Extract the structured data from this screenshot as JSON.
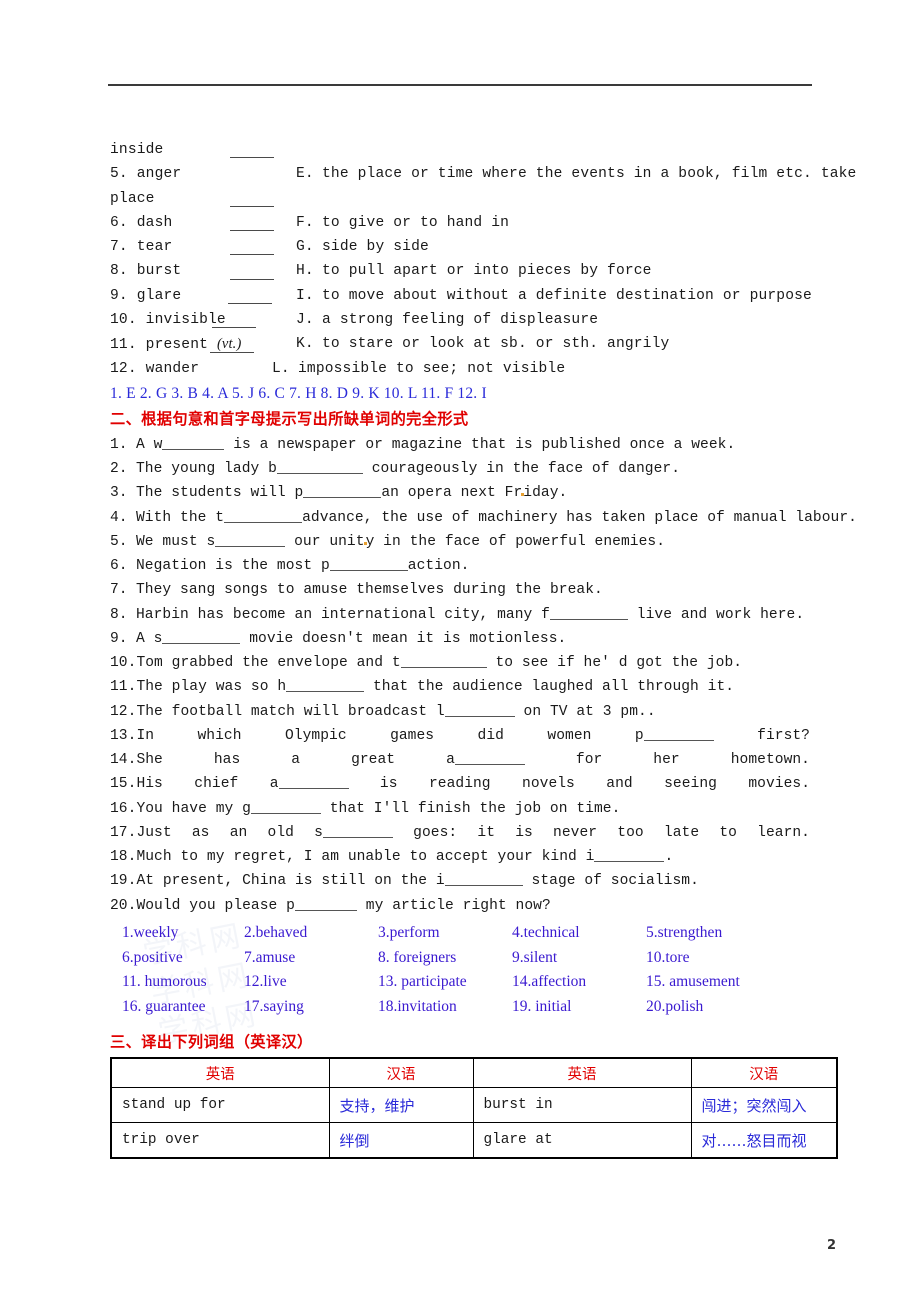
{
  "page": {
    "number": "2",
    "watermark_text": "学科网"
  },
  "matching": {
    "continued_word": "inside",
    "wrapped_word": "place",
    "rows": [
      {
        "num": "5.",
        "term": "anger",
        "vt": "",
        "letter": "E.",
        "definition": "the place or time where the events in a book, film etc. take"
      },
      {
        "num": "6.",
        "term": "dash",
        "vt": "",
        "letter": "F.",
        "definition": "to give or to hand in"
      },
      {
        "num": "7.",
        "term": "tear",
        "vt": "",
        "letter": "G.",
        "definition": "side by side"
      },
      {
        "num": "8.",
        "term": "burst",
        "vt": "",
        "letter": "H.",
        "definition": "to pull apart or into pieces by force"
      },
      {
        "num": "9.",
        "term": "glare",
        "vt": "",
        "letter": "I.",
        "definition": "to move about without a definite destination or purpose"
      },
      {
        "num": "10.",
        "term": "invisible",
        "vt": "",
        "letter": "J.",
        "definition": "a strong feeling of displeasure"
      },
      {
        "num": "11.",
        "term": "present",
        "vt": "(vt.)",
        "letter": "K.",
        "definition": "to stare or look at sb. or sth. angrily"
      },
      {
        "num": "12.",
        "term": "wander",
        "vt": "",
        "letter": "L.",
        "definition": "impossible to see; not visible"
      }
    ],
    "answer_key": "1. E 2. G 3. B 4. A 5. J 6. C 7. H 8. D 9. K 10. L 11. F 12. I"
  },
  "section2": {
    "heading": "二、根据句意和首字母提示写出所缺单词的完全形式",
    "sentences": [
      {
        "num": "1.",
        "pre": "A w",
        "blank": "b6",
        "post": " is a newspaper or magazine that is published once a week."
      },
      {
        "num": "2.",
        "pre": "The young lady b",
        "blank": "b9",
        "post": " courageously in the face of danger."
      },
      {
        "num": "3.",
        "pre": "The students will p",
        "blank": "b8",
        "post": "an opera next Friday."
      },
      {
        "num": "4.",
        "pre": "With the t",
        "blank": "b8",
        "post": "advance, the use of machinery has taken place of manual labour."
      },
      {
        "num": "5.",
        "pre": "We must s",
        "blank": "b7",
        "post": " our unity in the face of powerful enemies."
      },
      {
        "num": "6.",
        "pre": "Negation is the most p",
        "blank": "b8",
        "post": "action."
      },
      {
        "num": "7.",
        "pre": "They sang songs to amuse themselves during the break.",
        "blank": "",
        "post": ""
      },
      {
        "num": "8.",
        "pre": "Harbin has become an international city, many f",
        "blank": "b8",
        "post": " live and work here."
      },
      {
        "num": "9.",
        "pre": "A s",
        "blank": "b8",
        "post": " movie doesn't mean it is motionless."
      },
      {
        "num": "10.",
        "pre": "Tom grabbed the envelope and t",
        "blank": "b9",
        "post": " to see if he' d got the job."
      },
      {
        "num": "11.",
        "pre": "The play was so h",
        "blank": "b8",
        "post": " that the audience laughed all through it."
      },
      {
        "num": "12.",
        "pre": "The football match will broadcast l",
        "blank": "b7",
        "post": " on TV at 3 pm.."
      },
      {
        "num": "13.",
        "pre": "In which Olympic games did women p",
        "blank": "b7",
        "post": " first?"
      },
      {
        "num": "14.",
        "pre": "She has a great a",
        "blank": "b7",
        "post": " for her hometown."
      },
      {
        "num": "15.",
        "pre": "His chief a",
        "blank": "b7",
        "post": " is reading novels and seeing movies."
      },
      {
        "num": "16.",
        "pre": "You have my  g",
        "blank": "b7",
        "post": " that I'll finish the job on time."
      },
      {
        "num": "17.",
        "pre": "Just as an old s",
        "blank": "b7",
        "post": " goes: it is never too late to learn."
      },
      {
        "num": "18.",
        "pre": "Much to my regret, I am unable to accept your kind i",
        "blank": "b7",
        "post": "."
      },
      {
        "num": "19.",
        "pre": "At present, China is still on the i",
        "blank": "b8",
        "post": " stage of socialism."
      },
      {
        "num": "20.",
        "pre": "Would you please p",
        "blank": "b6",
        "post": " my article right now?"
      }
    ],
    "answers": [
      [
        "1.weekly",
        "2.behaved",
        "3.perform",
        "4.technical",
        "5.strengthen"
      ],
      [
        "6.positive",
        "7.amuse",
        "8. foreigners",
        "9.silent",
        "10.tore"
      ],
      [
        "11. humorous",
        "12.live",
        "13. participate",
        "14.affection",
        "15. amusement"
      ],
      [
        "16. guarantee",
        "17.saying",
        "18.invitation",
        "19. initial",
        "20.polish"
      ]
    ]
  },
  "section3": {
    "heading": "三、译出下列词组（英译汉）",
    "table": {
      "headers": [
        "英语",
        "汉语",
        "英语",
        "汉语"
      ],
      "rows": [
        [
          "stand up for",
          "支持，维护",
          "burst in",
          "闯进；突然闯入"
        ],
        [
          "trip over",
          "绊倒",
          "glare at",
          "对……怒目而视"
        ]
      ]
    }
  },
  "colors": {
    "heading_red": "#e00000",
    "answer_blue": "#2a2ad8",
    "text_black": "#1a1a1a"
  }
}
